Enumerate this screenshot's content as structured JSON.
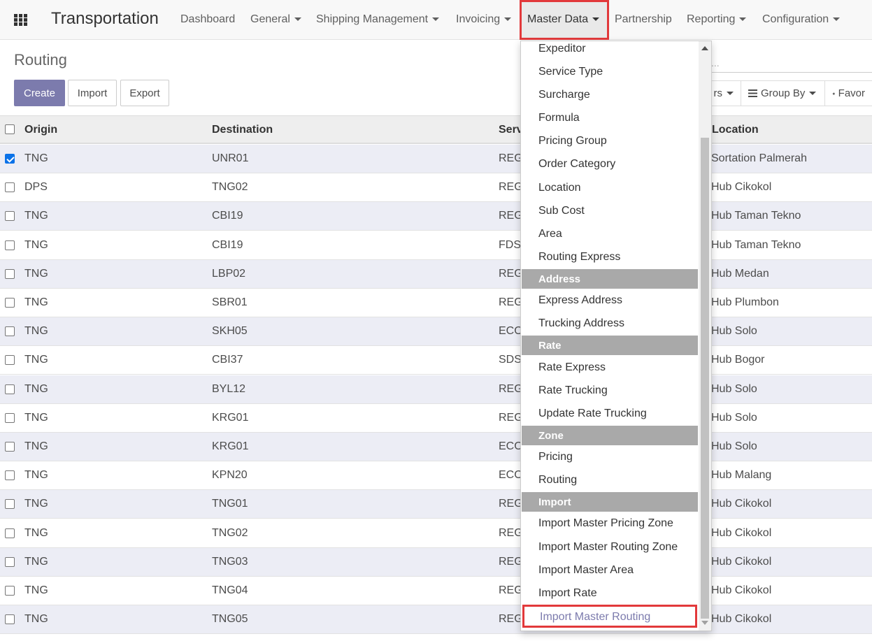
{
  "navbar": {
    "brand": "Transportation",
    "items": [
      {
        "label": "Dashboard",
        "caret": false
      },
      {
        "label": "General",
        "caret": true
      },
      {
        "label": "Shipping Management",
        "caret": true
      },
      {
        "label": "Invoicing",
        "caret": true
      },
      {
        "label": "Master Data",
        "caret": true,
        "active": true
      },
      {
        "label": "Partnership",
        "caret": false
      },
      {
        "label": "Reporting",
        "caret": true
      },
      {
        "label": "Configuration",
        "caret": true
      }
    ]
  },
  "control_panel": {
    "title": "Routing",
    "create_label": "Create",
    "import_label": "Import",
    "export_label": "Export",
    "search_placeholder": "...",
    "filters_label": "rs",
    "group_by_label": "Group By",
    "favorites_label": "Favor"
  },
  "table": {
    "columns": [
      "Origin",
      "Destination",
      "Servi",
      "Location"
    ],
    "rows": [
      {
        "checked": true,
        "origin": "TNG",
        "destination": "UNR01",
        "service": "REG",
        "location": "Sortation Palmerah"
      },
      {
        "checked": false,
        "origin": "DPS",
        "destination": "TNG02",
        "service": "REG",
        "location": "Hub Cikokol"
      },
      {
        "checked": false,
        "origin": "TNG",
        "destination": "CBI19",
        "service": "REG",
        "location": "Hub Taman Tekno"
      },
      {
        "checked": false,
        "origin": "TNG",
        "destination": "CBI19",
        "service": "FDS",
        "location": "Hub Taman Tekno"
      },
      {
        "checked": false,
        "origin": "TNG",
        "destination": "LBP02",
        "service": "REG",
        "location": "Hub Medan"
      },
      {
        "checked": false,
        "origin": "TNG",
        "destination": "SBR01",
        "service": "REG",
        "location": "Hub Plumbon"
      },
      {
        "checked": false,
        "origin": "TNG",
        "destination": "SKH05",
        "service": "ECO",
        "location": "Hub Solo"
      },
      {
        "checked": false,
        "origin": "TNG",
        "destination": "CBI37",
        "service": "SDS",
        "location": "Hub Bogor"
      },
      {
        "checked": false,
        "origin": "TNG",
        "destination": "BYL12",
        "service": "REG",
        "location": "Hub Solo"
      },
      {
        "checked": false,
        "origin": "TNG",
        "destination": "KRG01",
        "service": "REG",
        "location": "Hub Solo"
      },
      {
        "checked": false,
        "origin": "TNG",
        "destination": "KRG01",
        "service": "ECO",
        "location": "Hub Solo"
      },
      {
        "checked": false,
        "origin": "TNG",
        "destination": "KPN20",
        "service": "ECO",
        "location": "Hub Malang"
      },
      {
        "checked": false,
        "origin": "TNG",
        "destination": "TNG01",
        "service": "REG",
        "location": "Hub Cikokol"
      },
      {
        "checked": false,
        "origin": "TNG",
        "destination": "TNG02",
        "service": "REG",
        "location": "Hub Cikokol"
      },
      {
        "checked": false,
        "origin": "TNG",
        "destination": "TNG03",
        "service": "REG",
        "location": "Hub Cikokol"
      },
      {
        "checked": false,
        "origin": "TNG",
        "destination": "TNG04",
        "service": "REG",
        "location": "Hub Cikokol"
      },
      {
        "checked": false,
        "origin": "TNG",
        "destination": "TNG05",
        "service": "REG",
        "location": "Hub Cikokol"
      }
    ]
  },
  "dropdown": {
    "entries": [
      {
        "type": "item",
        "label": "Expeditor"
      },
      {
        "type": "item",
        "label": "Service Type"
      },
      {
        "type": "item",
        "label": "Surcharge"
      },
      {
        "type": "item",
        "label": "Formula"
      },
      {
        "type": "item",
        "label": "Pricing Group"
      },
      {
        "type": "item",
        "label": "Order Category"
      },
      {
        "type": "item",
        "label": "Location"
      },
      {
        "type": "item",
        "label": "Sub Cost"
      },
      {
        "type": "item",
        "label": "Area"
      },
      {
        "type": "item",
        "label": "Routing Express"
      },
      {
        "type": "header",
        "label": "Address"
      },
      {
        "type": "item",
        "label": "Express Address"
      },
      {
        "type": "item",
        "label": "Trucking Address"
      },
      {
        "type": "header",
        "label": "Rate"
      },
      {
        "type": "item",
        "label": "Rate Express"
      },
      {
        "type": "item",
        "label": "Rate Trucking"
      },
      {
        "type": "item",
        "label": "Update Rate Trucking"
      },
      {
        "type": "header",
        "label": "Zone"
      },
      {
        "type": "item",
        "label": "Pricing"
      },
      {
        "type": "item",
        "label": "Routing"
      },
      {
        "type": "header",
        "label": "Import"
      },
      {
        "type": "item",
        "label": "Import Master Pricing Zone"
      },
      {
        "type": "item",
        "label": "Import Master Routing Zone"
      },
      {
        "type": "item",
        "label": "Import Master Area"
      },
      {
        "type": "item",
        "label": "Import Rate"
      },
      {
        "type": "highlight",
        "label": "Import Master Routing"
      }
    ]
  },
  "colors": {
    "accent": "#7c7bad",
    "highlight_border": "#e2393b",
    "row_stripe": "#ecedf5",
    "header_bg": "#a9a9a9"
  }
}
